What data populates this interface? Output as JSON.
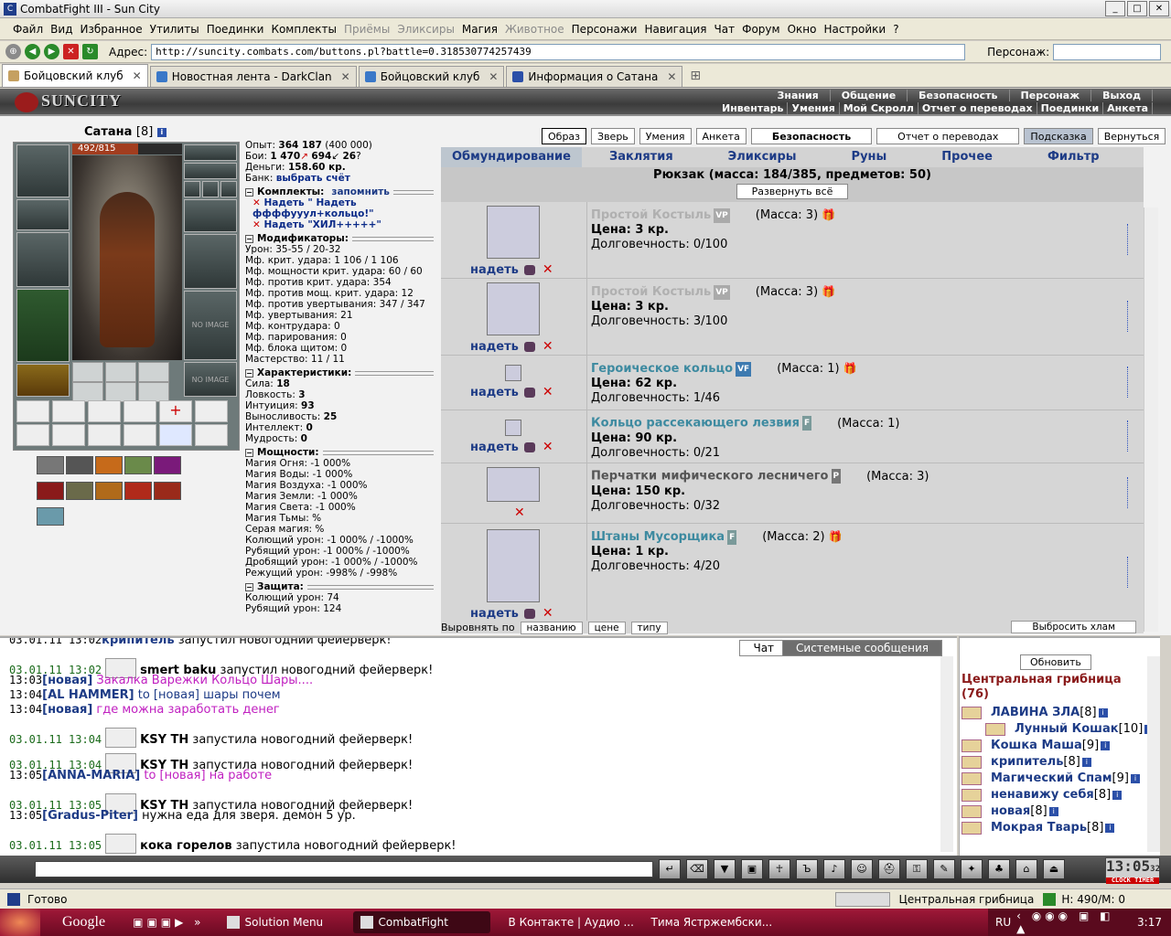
{
  "window": {
    "title": "CombatFight III - Sun City"
  },
  "menu": [
    "Файл",
    "Вид",
    "Избранное",
    "Утилиты",
    "Поединки",
    "Комплекты",
    "Приёмы",
    "Эликсиры",
    "Магия",
    "Животное",
    "Персонажи",
    "Навигация",
    "Чат",
    "Форум",
    "Окно",
    "Настройки",
    "?"
  ],
  "menu_disabled": [
    false,
    false,
    false,
    false,
    false,
    false,
    true,
    true,
    false,
    true,
    false,
    false,
    false,
    false,
    false,
    false,
    false
  ],
  "address": {
    "label": "Адрес:",
    "url": "http://suncity.combats.com/buttons.pl?battle=0.318530774257439",
    "pers_label": "Персонаж:"
  },
  "tabs": [
    {
      "label": "Бойцовский клуб",
      "active": true
    },
    {
      "label": "Новостная лента - DarkClan"
    },
    {
      "label": "Бойцовский клуб"
    },
    {
      "label": "Информация о Сатана"
    }
  ],
  "banner": {
    "logo": "SUNCITY",
    "links1": [
      "Знания",
      "Общение",
      "Безопасность",
      "Персонаж",
      "Выход"
    ],
    "links2": [
      "Инвентарь",
      "Умения",
      "Мой Скролл",
      "Отчет о переводах",
      "Поединки",
      "Анкета"
    ]
  },
  "character": {
    "name": "Сатана",
    "level": "[8]",
    "hp": "492/815",
    "hp_fraction": 0.604,
    "no_image": "NO IMAGE"
  },
  "stats": {
    "exp_label": "Опыт:",
    "exp": "364 187",
    "exp_next": "(400 000)",
    "fights_label": "Бои:",
    "wins": "1 470",
    "losses": "694",
    "draws": "26",
    "money_label": "Деньги:",
    "money": "158.60 кр.",
    "bank_label": "Банк:",
    "bank_link": "выбрать счёт",
    "sets_header": "Комплекты:",
    "remember": "запомнить",
    "set1": "Надеть \" Надеть ффффууул+кольцо!\"",
    "set2": "Надеть \"ХИЛ+++++\"",
    "mods_header": "Модификаторы:",
    "mods": [
      "Урон: 35-55 / 20-32",
      "Мф. крит. удара: 1 106 / 1 106",
      "Мф. мощности крит. удара: 60 / 60",
      "Мф. против крит. удара: 354",
      "Мф. против мощ. крит. удара: 12",
      "Мф. против увертывания: 347 / 347",
      "Мф. увертывания: 21",
      "Мф. контрудара: 0",
      "Мф. парирования: 0",
      "Мф. блока щитом: 0",
      "Мастерство: 11 / 11"
    ],
    "chars_header": "Характеристики:",
    "chars": [
      {
        "k": "Сила:",
        "v": "18"
      },
      {
        "k": "Ловкость:",
        "v": "3"
      },
      {
        "k": "Интуиция:",
        "v": "93"
      },
      {
        "k": "Выносливость:",
        "v": "25"
      },
      {
        "k": "Интеллект:",
        "v": "0"
      },
      {
        "k": "Мудрость:",
        "v": "0"
      }
    ],
    "power_header": "Мощности:",
    "power": [
      "Магия Огня: -1 000%",
      "Магия Воды: -1 000%",
      "Магия Воздуха: -1 000%",
      "Магия Земли: -1 000%",
      "Магия Света: -1 000%",
      "Магия Тьмы: %",
      "Серая магия: %",
      "Колющий урон: -1 000% / -1000%",
      "Рубящий урон: -1 000% / -1000%",
      "Дробящий урон: -1 000% / -1000%",
      "Режущий урон: -998% / -998%"
    ],
    "def_header": "Защита:",
    "def": [
      "Колющий урон: 74",
      "Рубящий урон: 124"
    ]
  },
  "topbuttons": [
    "Образ",
    "Зверь",
    "Умения",
    "Анкета",
    "Безопасность",
    "Отчет о переводах",
    "Подсказка",
    "Вернуться"
  ],
  "categories": [
    "Обмундирование",
    "Заклятия",
    "Эликсиры",
    "Руны",
    "Прочее",
    "Фильтр"
  ],
  "backpack": {
    "title": "Рюкзак (масса: 184/385, предметов: 50)",
    "expand": "Развернуть всё"
  },
  "items": [
    {
      "name": "Простой Костыль",
      "badge": "VP",
      "mass": "(Масса: 3)",
      "price": "Цена: 3 кр.",
      "dur": "Долговечность: 0/100",
      "put": "надеть"
    },
    {
      "name": "Простой Костыль",
      "badge": "VP",
      "mass": "(Масса: 3)",
      "price": "Цена: 3 кр.",
      "dur": "Долговечность: 3/100",
      "put": "надеть"
    },
    {
      "name": "Героическое кольцо",
      "badge": "VF",
      "mass": "(Масса: 1)",
      "price": "Цена: 62 кр.",
      "dur": "Долговечность: 1/46",
      "put": "надеть"
    },
    {
      "name": "Кольцо рассекающего лезвия",
      "badge": "F",
      "mass": "(Масса: 1)",
      "price": "Цена: 90 кр.",
      "dur": "Долговечность: 0/21",
      "put": "надеть"
    },
    {
      "name": "Перчатки мифического лесничего",
      "badge": "P",
      "mass": "(Масса: 3)",
      "price": "Цена: 150 кр.",
      "dur": "Долговечность: 0/32",
      "put": ""
    },
    {
      "name": "Штаны Мусорщика",
      "badge": "F",
      "mass": "(Масса: 2)",
      "price": "Цена: 1 кр.",
      "dur": "Долговечность: 4/20",
      "put": "надеть"
    }
  ],
  "sort": {
    "label": "Выровнять по",
    "by": [
      "названию",
      "цене",
      "типу"
    ],
    "junk": "Выбросить хлам"
  },
  "chat": {
    "tabs": [
      "Чат",
      "Системные сообщения"
    ],
    "lines": [
      {
        "ts": "03.01.11 13:02",
        "nick": "крипитель",
        "text": "запустил новогодний фейерверк!",
        "fw": false
      },
      {
        "ts": "03.01.11 13:02",
        "nick": "smert baku",
        "text": "запустил новогодний фейерверк!",
        "fw": true
      },
      {
        "ts": "13:03",
        "nick": "[новая]",
        "text": "Закалка Варежки Кольцо Шары....",
        "pink": true
      },
      {
        "ts": "13:04",
        "nick": "[AL HAMMER]",
        "text": "to [новая] шары почем",
        "to": true
      },
      {
        "ts": "13:04",
        "nick": "[новая]",
        "text": "где можна заработать денег",
        "pink": true
      },
      {
        "ts": "03.01.11 13:04",
        "nick": "KSY TH",
        "text": "запустила новогодний фейерверк!",
        "fw": true
      },
      {
        "ts": "03.01.11 13:04",
        "nick": "KSY TH",
        "text": "запустила новогодний фейерверк!",
        "fw": true
      },
      {
        "ts": "13:05",
        "nick": "[ANNA-MARIA]",
        "text": "to [новая] на работе",
        "pink": true
      },
      {
        "ts": "03.01.11 13:05",
        "nick": "KSY TH",
        "text": "запустила новогодний фейерверк!",
        "fw": true
      },
      {
        "ts": "13:05",
        "nick": "[Gradus-Piter]",
        "text": "нужна еда для зверя. демон 5 ур."
      },
      {
        "ts": "03.01.11 13:05",
        "nick": "кока горелов",
        "text": "запустила новогодний фейерверк!",
        "fw": true
      }
    ]
  },
  "online": {
    "refresh": "Обновить",
    "room": "Центральная грибница",
    "count": "(76)",
    "users": [
      {
        "n": "ЛАВИНА ЗЛА",
        "l": "[8]"
      },
      {
        "n": "Лунный Кошак",
        "l": "[10]"
      },
      {
        "n": "Кошка Маша",
        "l": "[9]"
      },
      {
        "n": "крипитель",
        "l": "[8]"
      },
      {
        "n": "Магический Спам",
        "l": "[9]"
      },
      {
        "n": "ненавижу себя",
        "l": "[8]"
      },
      {
        "n": "новая",
        "l": "[8]"
      },
      {
        "n": "Мокрая Тварь",
        "l": "[8]"
      }
    ]
  },
  "clock": {
    "time": "13:05",
    "sec": "32",
    "label": "CLOCK",
    "timer": "TIMER"
  },
  "status": {
    "text": "Готово",
    "room": "Центральная грибница",
    "hm": "H: 490/M: 0"
  },
  "taskbar": {
    "google": "Google",
    "tasks": [
      "Solution Menu",
      "CombatFight",
      "В Контакте | Аудио ...",
      "Тима Ястржембски..."
    ],
    "lang": "RU",
    "time": "3:17"
  },
  "colors": {
    "link_blue": "#1d3b86",
    "room_red": "#8a1a1a",
    "taskbar": "#a01838"
  }
}
